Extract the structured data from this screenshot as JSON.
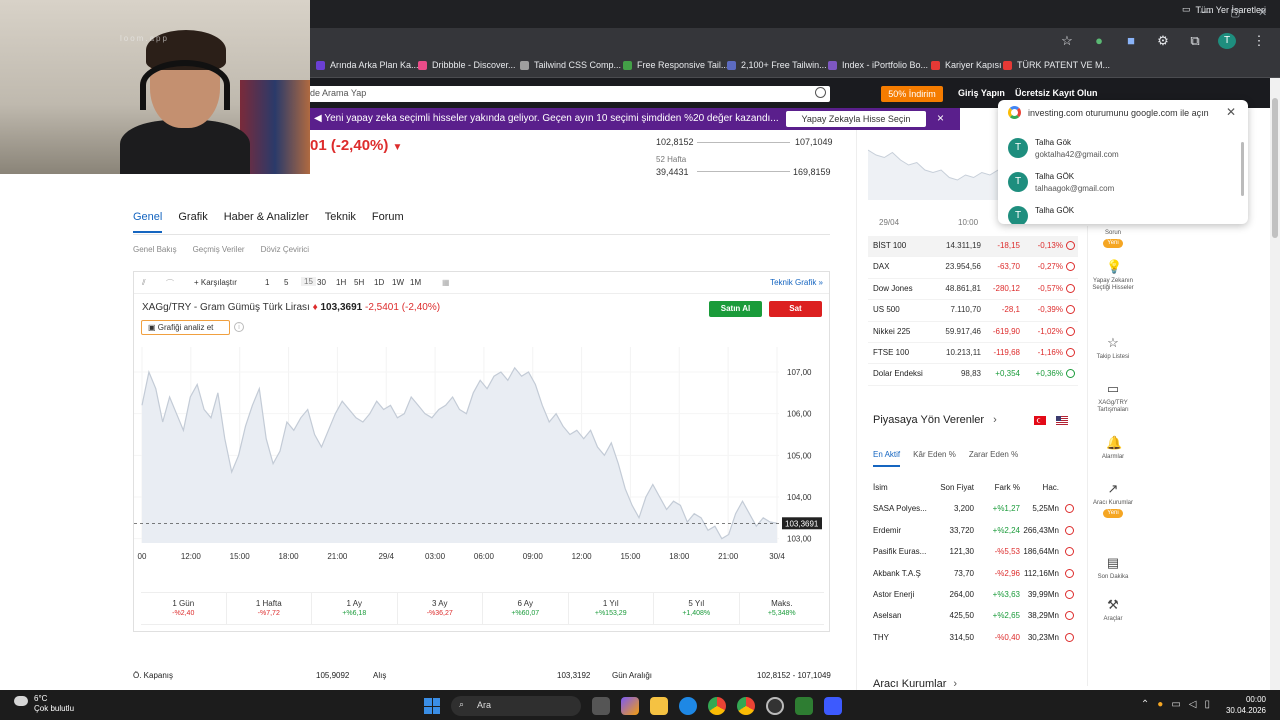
{
  "browser": {
    "bookmarks": [
      {
        "label": "Arında Arka Plan Ka...",
        "color": "#6b3fd4"
      },
      {
        "label": "Dribbble - Discover...",
        "color": "#ea4c89"
      },
      {
        "label": "Tailwind CSS Comp...",
        "color": "#9e9e9e"
      },
      {
        "label": "Free Responsive Tail...",
        "color": "#43a047"
      },
      {
        "label": "2,100+ Free Tailwin...",
        "color": "#5c6bc0"
      },
      {
        "label": "Index - iPortfolio Bo...",
        "color": "#7e57c2"
      },
      {
        "label": "Kariyer Kapısı",
        "color": "#e53935"
      },
      {
        "label": "TÜRK PATENT VE M...",
        "color": "#e53935"
      }
    ],
    "all_bookmarks": "Tüm Yer İşaretleri",
    "profile_initial": "T"
  },
  "header": {
    "search_placeholder": "de Arama Yap",
    "discount": "50% İndirim",
    "login": "Giriş Yapın",
    "register": "Ücretsiz Kayıt Olun"
  },
  "banner": {
    "text": "Yeni yapay zeka seçimli hisseler yakında geliyor. Geçen ayın 10 seçimi şimdiden %20 değer kazandı...",
    "button": "Yapay Zekayla Hisse Seçin",
    "close": "×"
  },
  "webcam": {
    "overlay_text": "loom.app"
  },
  "quote": {
    "change_partial": "01 (-2,40%)",
    "day_low": "102,8152",
    "day_high": "107,1049",
    "week52_label_1": "52 Hafta",
    "week52_low": "39,4431",
    "week52_high": "169,8159"
  },
  "tabs": [
    "Genel",
    "Grafik",
    "Haber & Analizler",
    "Teknik",
    "Forum"
  ],
  "subtabs": [
    "Genel Bakış",
    "Geçmiş Veriler",
    "Döviz Çevirici"
  ],
  "toolbar": {
    "compare": "Karşılaştır",
    "intervals": [
      "1",
      "5",
      "15",
      "30",
      "1H",
      "5H",
      "1D",
      "1W",
      "1M"
    ],
    "tech_chart": "Teknik Grafik »"
  },
  "instrument": {
    "name": "XAGg/TRY - Gram Gümüş Türk Lirası",
    "price": "103,3691",
    "change": "-2,5401 (-2,40%)",
    "buy": "Satın Al",
    "sell": "Sat",
    "analyze": "Grafiği analiz et",
    "watermark": "Investing",
    "watermark_suffix": ".com"
  },
  "chart_data": {
    "type": "area",
    "x_tick_labels": [
      "00",
      "12:00",
      "15:00",
      "18:00",
      "21:00",
      "29/4",
      "03:00",
      "06:00",
      "09:00",
      "12:00",
      "15:00",
      "18:00",
      "21:00",
      "30/4"
    ],
    "y_tick_labels": [
      "107,00",
      "106,00",
      "105,00",
      "104,00",
      "103,00"
    ],
    "ylim": [
      102.8,
      107.6
    ],
    "current_value": 103.3691,
    "current_label": "103,3691",
    "values": [
      106.2,
      107.0,
      106.6,
      105.8,
      106.4,
      106.0,
      105.6,
      106.4,
      106.7,
      106.1,
      105.9,
      106.5,
      105.4,
      104.6,
      105.0,
      105.7,
      106.2,
      106.6,
      105.4,
      104.8,
      105.1,
      105.8,
      105.6,
      105.9,
      106.1,
      105.5,
      105.2,
      105.6,
      106.0,
      106.3,
      106.1,
      105.9,
      105.8,
      106.0,
      106.3,
      106.1,
      106.2,
      105.9,
      106.0,
      106.4,
      106.2,
      106.0,
      105.9,
      106.1,
      106.2,
      106.4,
      106.1,
      106.0,
      106.5,
      106.8,
      106.6,
      106.9,
      107.0,
      106.8,
      107.1,
      106.9,
      107.0,
      106.7,
      106.2,
      105.8,
      106.0,
      105.7,
      105.5,
      105.6,
      105.4,
      105.6,
      105.2,
      105.0,
      105.3,
      104.8,
      104.2,
      103.8,
      103.5,
      104.0,
      104.3,
      104.0,
      103.7,
      103.9,
      103.8,
      103.4,
      103.6,
      103.5,
      103.2,
      103.3,
      103.0,
      103.1,
      103.6,
      103.9,
      103.6,
      103.3,
      103.5,
      103.4,
      103.37
    ]
  },
  "periods": [
    {
      "label": "1 Gün",
      "change": "-%2,40",
      "dir": "neg"
    },
    {
      "label": "1 Hafta",
      "change": "-%7,72",
      "dir": "neg"
    },
    {
      "label": "1 Ay",
      "change": "+%6,18",
      "dir": "pos"
    },
    {
      "label": "3 Ay",
      "change": "-%36,27",
      "dir": "neg"
    },
    {
      "label": "6 Ay",
      "change": "+%60,07",
      "dir": "pos"
    },
    {
      "label": "1 Yıl",
      "change": "+%153,29",
      "dir": "pos"
    },
    {
      "label": "5 Yıl",
      "change": "+1,408%",
      "dir": "pos"
    },
    {
      "label": "Maks.",
      "change": "+5,348%",
      "dir": "pos"
    }
  ],
  "bottom_stats": {
    "prev_close_label": "Ö. Kapanış",
    "prev_close": "105,9092",
    "bid_label": "Alış",
    "bid": "103,3192",
    "day_range_label": "Gün Aralığı",
    "day_range": "102,8152 - 107,1049"
  },
  "side_chart": {
    "times": [
      "29/04",
      "10:00"
    ],
    "values": [
      1.0,
      0.9,
      0.85,
      0.95,
      0.8,
      0.7,
      0.75,
      0.6,
      0.55,
      0.6,
      0.45,
      0.4,
      0.5,
      0.45,
      0.55,
      0.5,
      0.6
    ]
  },
  "indices": [
    {
      "name": "BİST 100",
      "value": "14.311,19",
      "chg": "-18,15",
      "pct": "-0,13%",
      "dir": "neg",
      "open": false
    },
    {
      "name": "DAX",
      "value": "23.954,56",
      "chg": "-63,70",
      "pct": "-0,27%",
      "dir": "neg",
      "open": false
    },
    {
      "name": "Dow Jones",
      "value": "48.861,81",
      "chg": "-280,12",
      "pct": "-0,57%",
      "dir": "neg",
      "open": false
    },
    {
      "name": "US 500",
      "value": "7.110,70",
      "chg": "-28,1",
      "pct": "-0,39%",
      "dir": "neg",
      "open": false
    },
    {
      "name": "Nikkei 225",
      "value": "59.917,46",
      "chg": "-619,90",
      "pct": "-1,02%",
      "dir": "neg",
      "open": false
    },
    {
      "name": "FTSE 100",
      "value": "10.213,11",
      "chg": "-119,68",
      "pct": "-1,16%",
      "dir": "neg",
      "open": false
    },
    {
      "name": "Dolar Endeksi",
      "value": "98,83",
      "chg": "+0,354",
      "pct": "+0,36%",
      "dir": "pos",
      "open": true
    }
  ],
  "movers": {
    "title": "Piyasaya Yön Verenler",
    "tabs": [
      "En Aktif",
      "Kâr Eden %",
      "Zarar Eden %"
    ],
    "headers": [
      "İsim",
      "Son Fiyat",
      "Fark %",
      "Hac."
    ],
    "rows": [
      {
        "name": "SASA Polyes...",
        "price": "3,200",
        "pct": "+%1,27",
        "vol": "5,25Mn",
        "dir": "pos"
      },
      {
        "name": "Erdemir",
        "price": "33,720",
        "pct": "+%2,24",
        "vol": "266,43Mn",
        "dir": "pos"
      },
      {
        "name": "Pasifik Euras...",
        "price": "121,30",
        "pct": "-%5,53",
        "vol": "186,64Mn",
        "dir": "neg"
      },
      {
        "name": "Akbank T.A.Ş",
        "price": "73,70",
        "pct": "-%2,96",
        "vol": "112,16Mn",
        "dir": "neg"
      },
      {
        "name": "Astor Enerji",
        "price": "264,00",
        "pct": "+%3,63",
        "vol": "39,99Mn",
        "dir": "pos"
      },
      {
        "name": "Aselsan",
        "price": "425,50",
        "pct": "+%2,65",
        "vol": "38,29Mn",
        "dir": "pos"
      },
      {
        "name": "THY",
        "price": "314,50",
        "pct": "-%0,40",
        "vol": "30,23Mn",
        "dir": "neg"
      }
    ],
    "brokers": "Aracı Kurumlar"
  },
  "rail": [
    {
      "icon": "",
      "label": "Sorun",
      "badge": "Yeni"
    },
    {
      "icon": "💡",
      "label": "Yapay Zekanın Seçtiği Hisseler",
      "badge": ""
    },
    {
      "icon": "☆",
      "label": "Takip Listesi",
      "badge": ""
    },
    {
      "icon": "▭",
      "label": "XAGg/TRY Tartışmaları",
      "badge": ""
    },
    {
      "icon": "🔔",
      "label": "Alarmlar",
      "badge": ""
    },
    {
      "icon": "↗",
      "label": "Aracı Kurumlar",
      "badge": "Yeni"
    },
    {
      "icon": "▤",
      "label": "Son Dakika",
      "badge": ""
    },
    {
      "icon": "⚒",
      "label": "Araçlar",
      "badge": ""
    }
  ],
  "google_popup": {
    "title": "investing.com oturumunu google.com ile açın",
    "accounts": [
      {
        "initial": "T",
        "name": "Talha Gök",
        "email": "goktalha42@gmail.com"
      },
      {
        "initial": "T",
        "name": "Talha GÖK",
        "email": "talhaagok@gmail.com"
      },
      {
        "initial": "T",
        "name": "Talha GÖK",
        "email": ""
      }
    ]
  },
  "taskbar": {
    "temp": "6°C",
    "weather": "Çok bulutlu",
    "search": "Ara",
    "time": "00:00",
    "date": "30.04.2026"
  }
}
